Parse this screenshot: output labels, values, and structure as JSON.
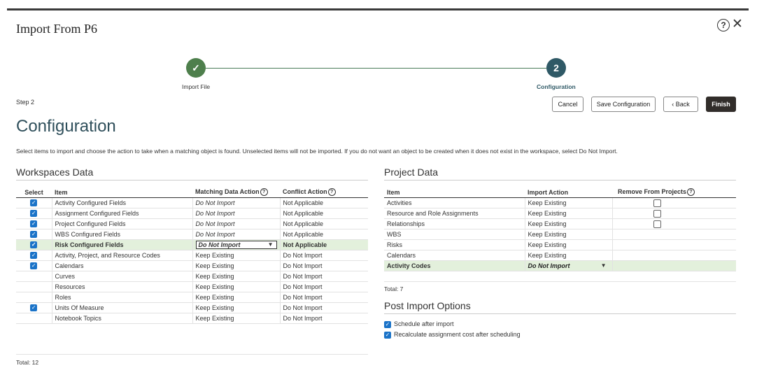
{
  "dialog": {
    "title": "Import From P6"
  },
  "train": {
    "step1_label": "Import File",
    "step2_number": "2",
    "step2_label": "Configuration"
  },
  "step_text": "Step 2",
  "buttons": {
    "cancel": "Cancel",
    "save_config": "Save Configuration",
    "back": "Back",
    "finish": "Finish"
  },
  "page_title": "Configuration",
  "description": "Select items to import and choose the action to take when a matching object is found. Unselected items will not be imported. If you do not want an object to be created when it does not exist in the workspace, select Do Not Import.",
  "workspaces": {
    "title": "Workspaces Data",
    "headers": {
      "select": "Select",
      "item": "Item",
      "matching": "Matching Data Action",
      "conflict": "Conflict Action"
    },
    "rows": [
      {
        "item": "Activity Configured Fields",
        "matching": "Do Not Import",
        "conflict": "Not Applicable"
      },
      {
        "item": "Assignment Configured Fields",
        "matching": "Do Not Import",
        "conflict": "Not Applicable"
      },
      {
        "item": "Project Configured Fields",
        "matching": "Do Not Import",
        "conflict": "Not Applicable"
      },
      {
        "item": "WBS Configured Fields",
        "matching": "Do Not Import",
        "conflict": "Not Applicable"
      },
      {
        "item": "Risk Configured Fields",
        "matching": "Do Not Import",
        "conflict": "Not Applicable"
      },
      {
        "item": "Activity, Project, and Resource Codes",
        "matching": "Keep Existing",
        "conflict": "Do Not Import"
      },
      {
        "item": "Calendars",
        "matching": "Keep Existing",
        "conflict": "Do Not Import"
      },
      {
        "item": "Curves",
        "matching": "Keep Existing",
        "conflict": "Do Not Import"
      },
      {
        "item": "Resources",
        "matching": "Keep Existing",
        "conflict": "Do Not Import"
      },
      {
        "item": "Roles",
        "matching": "Keep Existing",
        "conflict": "Do Not Import"
      },
      {
        "item": "Units Of Measure",
        "matching": "Keep Existing",
        "conflict": "Do Not Import"
      },
      {
        "item": "Notebook Topics",
        "matching": "Keep Existing",
        "conflict": "Do Not Import"
      }
    ],
    "total": "Total: 12"
  },
  "project": {
    "title": "Project Data",
    "headers": {
      "item": "Item",
      "action": "Import Action",
      "remove": "Remove From Projects"
    },
    "rows": [
      {
        "item": "Activities",
        "action": "Keep Existing"
      },
      {
        "item": "Resource and Role Assignments",
        "action": "Keep Existing"
      },
      {
        "item": "Relationships",
        "action": "Keep Existing"
      },
      {
        "item": "WBS",
        "action": "Keep Existing"
      },
      {
        "item": "Risks",
        "action": "Keep Existing"
      },
      {
        "item": "Calendars",
        "action": "Keep Existing"
      },
      {
        "item": "Activity Codes",
        "action": "Do Not Import"
      }
    ],
    "total": "Total: 7"
  },
  "post_import": {
    "title": "Post Import Options",
    "opt1": "Schedule after import",
    "opt2": "Recalculate assignment cost after scheduling"
  }
}
